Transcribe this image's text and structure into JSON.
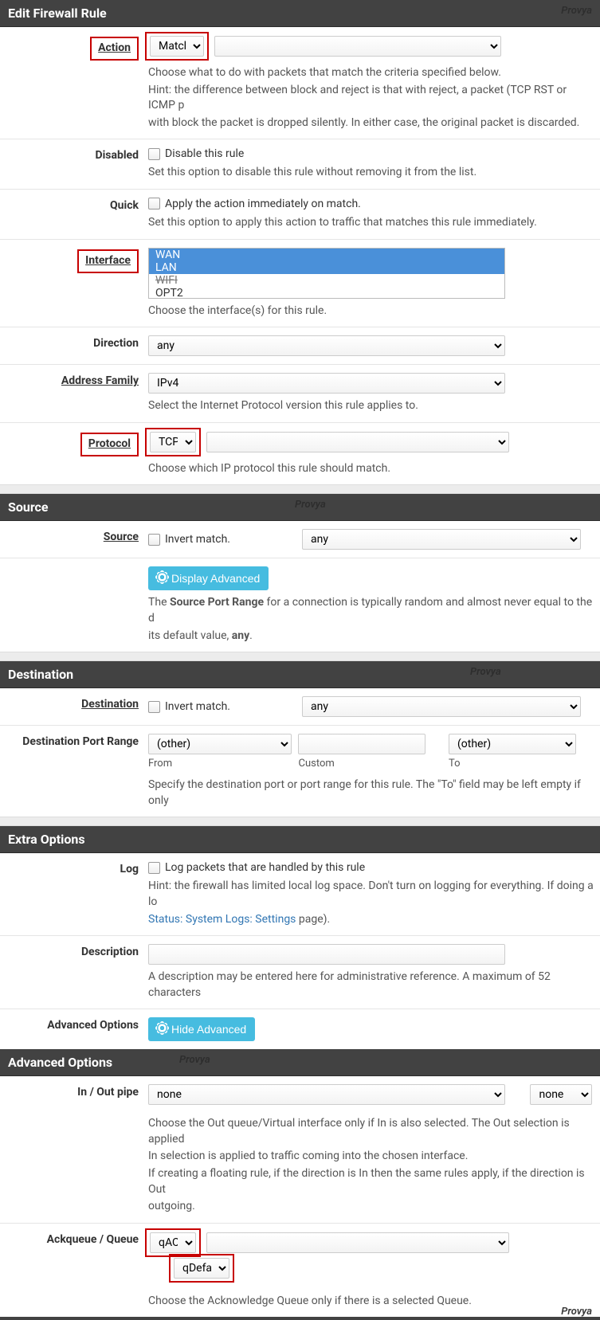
{
  "headers": {
    "edit": "Edit Firewall Rule",
    "source": "Source",
    "dest": "Destination",
    "extra": "Extra Options",
    "adv": "Advanced Options"
  },
  "watermark": "Provya",
  "action": {
    "label": "Action",
    "value": "Match",
    "hint1": "Choose what to do with packets that match the criteria specified below.",
    "hint2": "Hint: the difference between block and reject is that with reject, a packet (TCP RST or ICMP p",
    "hint3": "with block the packet is dropped silently. In either case, the original packet is discarded."
  },
  "disabled": {
    "label": "Disabled",
    "cb": "Disable this rule",
    "hint": "Set this option to disable this rule without removing it from the list."
  },
  "quick": {
    "label": "Quick",
    "cb": "Apply the action immediately on match.",
    "hint": "Set this option to apply this action to traffic that matches this rule immediately."
  },
  "interface": {
    "label": "Interface",
    "items": [
      "WAN",
      "LAN",
      "WIFI",
      "OPT2"
    ],
    "hint": "Choose the interface(s) for this rule."
  },
  "direction": {
    "label": "Direction",
    "value": "any"
  },
  "af": {
    "label": "Address Family",
    "value": "IPv4",
    "hint": "Select the Internet Protocol version this rule applies to."
  },
  "protocol": {
    "label": "Protocol",
    "value": "TCP",
    "hint": "Choose which IP protocol this rule should match."
  },
  "source": {
    "label": "Source",
    "invert": "Invert match.",
    "value": "any",
    "btn": "Display Advanced",
    "hint_pre": "The ",
    "hint_bold": "Source Port Range",
    "hint_post": " for a connection is typically random and almost never equal to the d",
    "hint2": "its default value, ",
    "hint2_bold": "any",
    "hint2_post": "."
  },
  "dest": {
    "label": "Destination",
    "invert": "Invert match.",
    "value": "any",
    "port_label": "Destination Port Range",
    "from": "(other)",
    "to": "(other)",
    "from_sub": "From",
    "custom_sub": "Custom",
    "to_sub": "To",
    "hint": "Specify the destination port or port range for this rule. The \"To\" field may be left empty if only"
  },
  "log": {
    "label": "Log",
    "cb": "Log packets that are handled by this rule",
    "hint": "Hint: the firewall has limited local log space. Don't turn on logging for everything. If doing a lo",
    "link": "Status: System Logs: Settings",
    "post": " page)."
  },
  "description": {
    "label": "Description",
    "hint": "A description may be entered here for administrative reference. A maximum of 52 characters"
  },
  "advopt": {
    "label": "Advanced Options",
    "btn": "Hide Advanced"
  },
  "pipe": {
    "label": "In / Out pipe",
    "a": "none",
    "b": "none",
    "hint1": "Choose the Out queue/Virtual interface only if In is also selected. The Out selection is applied",
    "hint2": "In selection is applied to traffic coming into the chosen interface.",
    "hint3": "If creating a floating rule, if the direction is In then the same rules apply, if the direction is Out",
    "hint4": "outgoing."
  },
  "queue": {
    "label": "Ackqueue / Queue",
    "a": "qACK",
    "b": "qDefaut",
    "hint": "Choose the Acknowledge Queue only if there is a selected Queue."
  }
}
